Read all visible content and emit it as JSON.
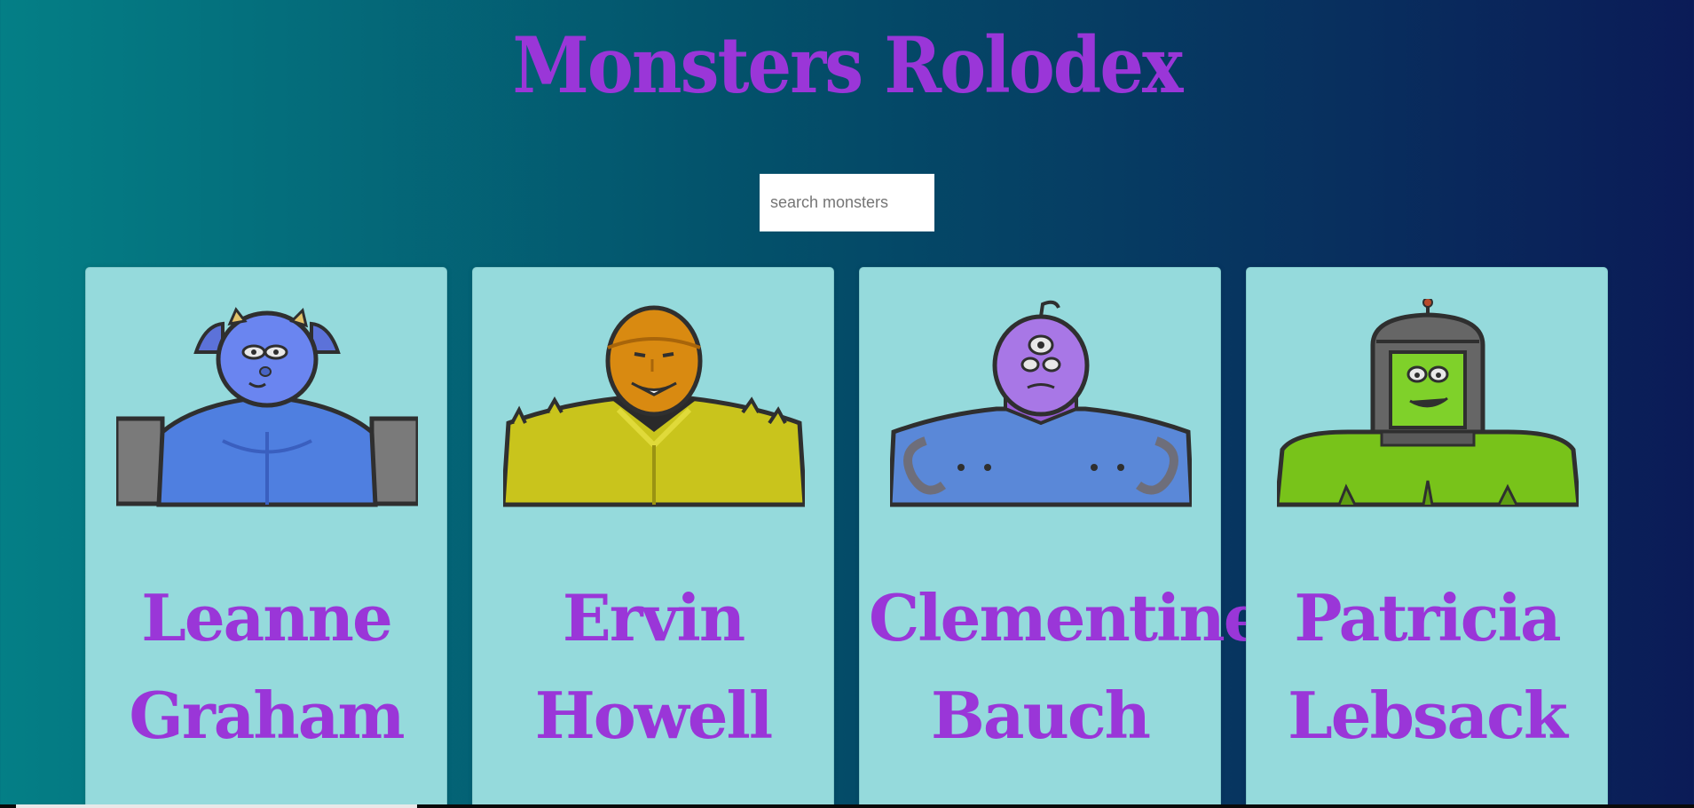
{
  "app": {
    "title": "Monsters Rolodex"
  },
  "search": {
    "placeholder": "search monsters",
    "value": ""
  },
  "monsters": [
    {
      "name": "Leanne Graham",
      "icon": "blue-horned-monster-icon",
      "colors": {
        "body": "#4f7fe0",
        "head": "#6a85f0",
        "shoulder": "#7a7a7a",
        "horn": "#e3c36a"
      }
    },
    {
      "name": "Ervin Howell",
      "icon": "orange-masked-monster-icon",
      "colors": {
        "body": "#c9c41c",
        "head": "#d98a11",
        "collar": "#2a2a2a"
      }
    },
    {
      "name": "Clementine Bauch",
      "icon": "purple-cyclops-robot-monster-icon",
      "colors": {
        "body": "#5a88d8",
        "head": "#a877e6",
        "hose": "#6e6e7a"
      }
    },
    {
      "name": "Patricia Lebsack",
      "icon": "green-helmet-monster-icon",
      "colors": {
        "body": "#78c31a",
        "head": "#7fd12a",
        "helmet": "#666666"
      }
    }
  ]
}
